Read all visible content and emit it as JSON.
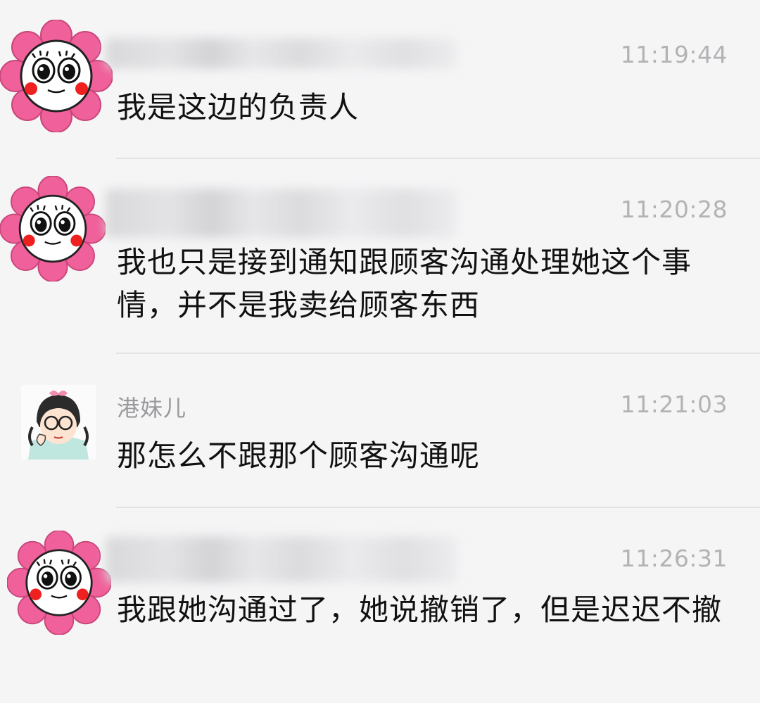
{
  "messages": [
    {
      "sender": "",
      "sender_blurred": true,
      "avatar": "pink-flower-avatar",
      "time": "11:19:44",
      "text": "我是这边的负责人"
    },
    {
      "sender": "",
      "sender_blurred": true,
      "avatar": "pink-flower-avatar",
      "time": "11:20:28",
      "text": "我也只是接到通知跟顾客沟通处理她这个事情，并不是我卖给顾客东西"
    },
    {
      "sender": "港妹儿",
      "sender_blurred": false,
      "avatar": "girl-cartoon-avatar",
      "time": "11:21:03",
      "text": "那怎么不跟那个顾客沟通呢"
    },
    {
      "sender": "",
      "sender_blurred": true,
      "avatar": "pink-flower-avatar",
      "time": "11:26:31",
      "text": "我跟她沟通过了，她说撤销了，但是迟迟不撤"
    }
  ],
  "colors": {
    "background": "#f5f5f6",
    "flower_petal": "#f0609a",
    "timestamp": "#b3b3b6",
    "sender": "#9a9a9e",
    "message_text": "#111111"
  }
}
